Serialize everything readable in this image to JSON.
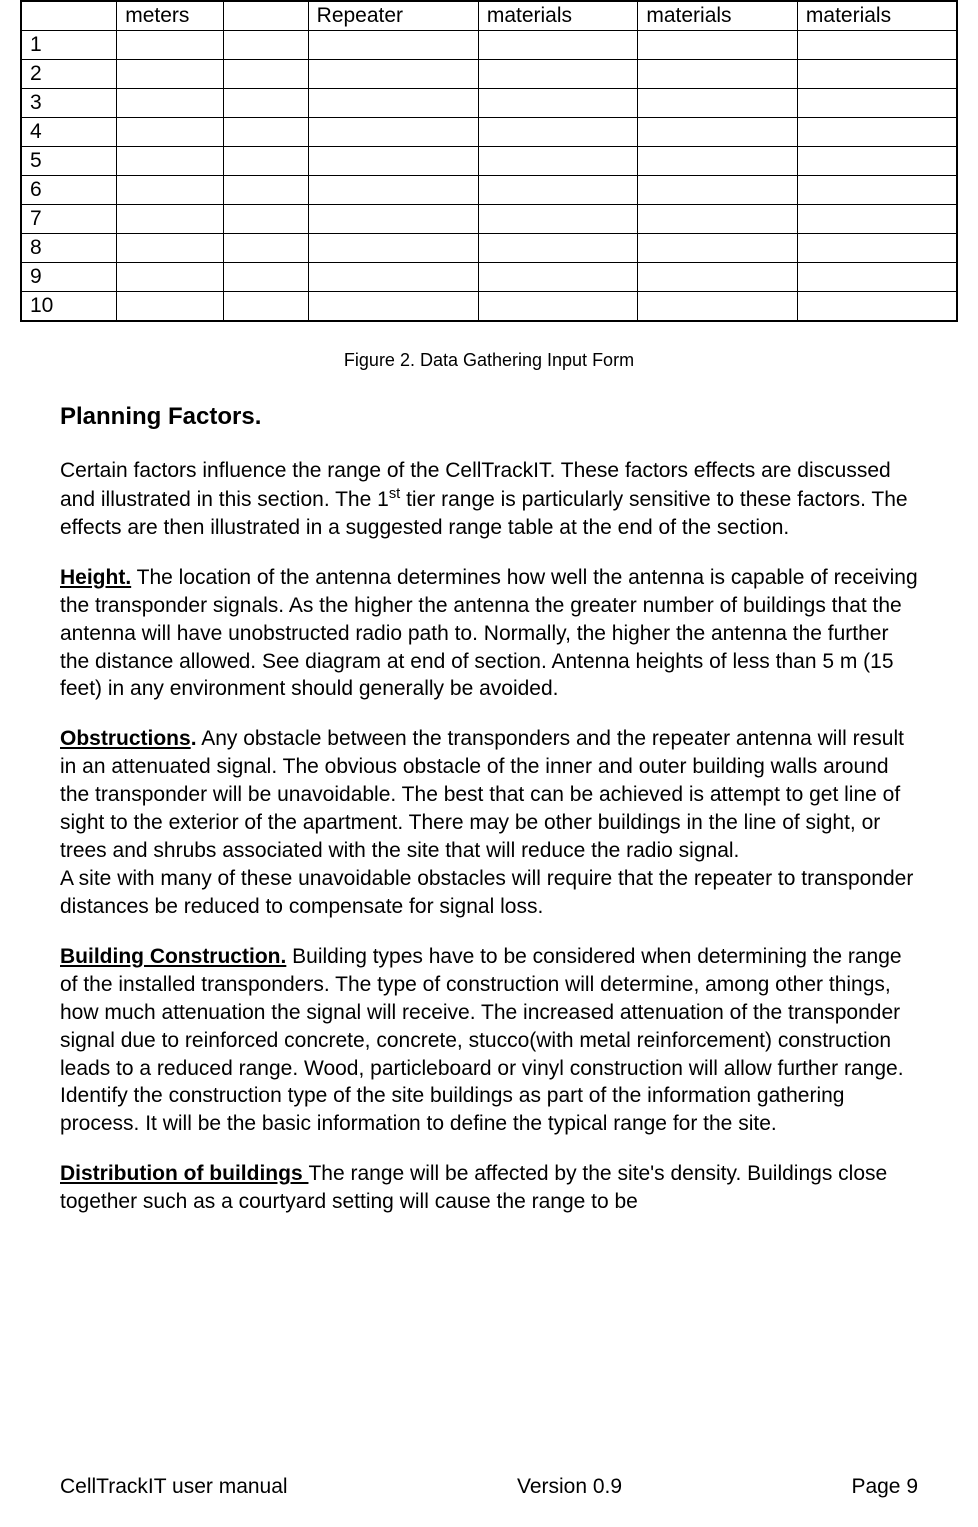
{
  "table": {
    "headers": [
      "",
      "meters",
      "",
      "Repeater",
      "materials",
      "materials",
      "materials"
    ],
    "rows": [
      "1",
      "2",
      "3",
      "4",
      "5",
      "6",
      "7",
      "8",
      "9",
      "10"
    ]
  },
  "caption": "Figure 2. Data Gathering Input Form",
  "heading": "Planning Factors.",
  "intro": "Certain factors influence the range of the CellTrackIT. These factors effects are discussed and illustrated in this section. The 1",
  "intro_sup": "st",
  "intro_after": " tier range is particularly sensitive to these factors. The effects are then illustrated in a suggested range table at the end of the section.",
  "height_label": "Height.",
  "height_text": "  The location of the antenna determines how well the antenna is capable of receiving the transponder signals. As the higher the antenna the greater number of buildings that the antenna will have unobstructed radio path to. Normally, the higher the antenna the further the distance allowed. See diagram at end of section. Antenna heights of less than 5 m (15 feet) in any environment should generally be avoided.",
  "obstructions_label": "Obstructions",
  "obstructions_dot": ".",
  "obstructions_text": " Any obstacle between the transponders and the repeater antenna will result in an attenuated signal.  The obvious obstacle of the inner and outer building walls around the transponder will be unavoidable. The best that can be achieved is attempt to get line of sight to the exterior of the apartment. There may be other buildings in the line of sight, or trees and shrubs associated with the site that will reduce the radio signal.",
  "obstructions_text2": " A site with many of these unavoidable obstacles will require that the repeater to transponder distances be reduced to compensate for signal loss.",
  "building_label": "Building Construction.",
  "building_text": "  Building types have to be considered when determining the range of the installed transponders. The type of construction will determine, among other things, how much attenuation the signal will receive. The increased attenuation of the transponder signal due to reinforced concrete, concrete, stucco(with metal reinforcement) construction leads to a reduced range.  Wood, particleboard or vinyl construction will allow further range.  Identify the construction type of the site buildings as part of the information gathering process.  It will be the basic information to define the typical range for the site.",
  "distribution_label": "Distribution of buildings ",
  "distribution_text": "The range will be affected by the site's density. Buildings close together such as a courtyard setting will cause the range to be",
  "footer": {
    "left": "CellTrackIT user manual",
    "center": "Version 0.9",
    "right": "Page 9"
  }
}
